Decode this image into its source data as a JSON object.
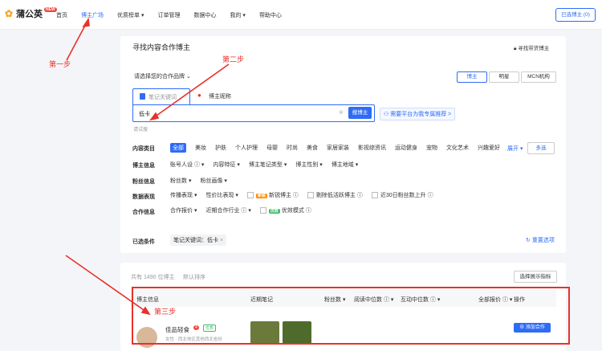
{
  "header": {
    "logo_text": "蒲公英",
    "logo_badge": "NEW",
    "nav": [
      "首页",
      "博主广场",
      "优质榜单 ▾",
      "订单管理",
      "数据中心",
      "我的 ▾",
      "帮助中心"
    ],
    "active_nav": "博主广场",
    "chosen_button": "已选博主 (0)"
  },
  "search": {
    "title": "寻找内容合作博主",
    "find_fans_link": "寻找带货博主",
    "brand_select": "请选择您的合作品牌",
    "type_tabs": [
      "博主",
      "明星",
      "MCN机构"
    ],
    "mode_tabs": [
      "笔记关键词",
      "博主昵称"
    ],
    "query_value": "低卡",
    "search_button": "搜博主",
    "helper_text": "请试搜",
    "recommend_link": "需要平台为我专属推荐 >"
  },
  "filters": {
    "content_category_label": "内容类目",
    "categories": [
      "全部",
      "美妆",
      "护肤",
      "个人护理",
      "母婴",
      "时尚",
      "美食",
      "家居家装",
      "影视综资讯",
      "运动健身",
      "宠物",
      "文化艺术",
      "兴趣爱好"
    ],
    "expand_label": "展开 ▾",
    "multi_button": "多选",
    "blogger_info_label": "博主信息",
    "blogger_info": [
      "账号人设 ⓘ ▾",
      "内容特征 ▾",
      "博主笔记类型 ▾",
      "博主性别 ▾",
      "博主地域 ▾"
    ],
    "fans_info_label": "粉丝信息",
    "fans_info": [
      "粉丝数 ▾",
      "粉丝画像 ▾"
    ],
    "data_label": "数据表现",
    "data_items": [
      "传播表现 ▾",
      "性价比表现 ▾"
    ],
    "new_tag": "新锐",
    "new_blogger": "新锐博主 ⓘ",
    "exclude_inactive": "剔除低活跃博主 ⓘ",
    "fans_growth": "近30日粉丝数上升 ⓘ",
    "coop_label": "合作信息",
    "coop_items": [
      "合作报价 ▾",
      "近期合作行业 ⓘ ▾"
    ],
    "efficiency_tag": "优效",
    "efficiency_mode": "优效模式 ⓘ"
  },
  "selected": {
    "label": "已选条件",
    "condition": "笔记关键词：低卡",
    "reset": "重置选项"
  },
  "results": {
    "count_text": "共有 1490 位博主",
    "sort_label": "默认排序",
    "display_button": "选择展示指标",
    "columns": [
      "博主信息",
      "近期笔记",
      "粉丝数 ▾",
      "阅读中位数 ⓘ ▾",
      "互动中位数 ⓘ ▾",
      "全部报价 ⓘ ▾",
      "操作"
    ],
    "row": {
      "name": "佳品轻食",
      "level": "4",
      "quality_badge": "优秀",
      "tags_text": "女性 · 西北地区其他西北省份",
      "add_button": "⊕ 添加合作"
    }
  },
  "annotations": {
    "step1": "第一步",
    "step2": "第二步",
    "step3": "第三步",
    "color": "#e8312a"
  }
}
